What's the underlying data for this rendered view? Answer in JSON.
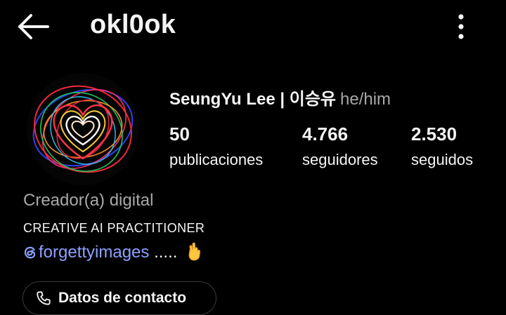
{
  "header": {
    "username": "okl0ok",
    "back_icon": "arrow-left-icon",
    "menu_icon": "kebab-menu-icon"
  },
  "profile": {
    "display_name": "SeungYu Lee | 이승유",
    "pronouns": "he/him",
    "avatar_icon": "neon-heart-avatar",
    "stats": [
      {
        "value": "50",
        "label": "publicaciones"
      },
      {
        "value": "4.766",
        "label": "seguidores"
      },
      {
        "value": "2.530",
        "label": "seguidos"
      }
    ],
    "category": "Creador(a) digital",
    "bio": "CREATIVE AI PRACTITIONER",
    "threads_handle": "forgettyimages",
    "threads_suffix": ".....",
    "threads_icon": "threads-icon",
    "emoji_icon": "crossed-fingers-emoji"
  },
  "contact_button": {
    "label": "Datos de contacto",
    "icon": "phone-icon"
  },
  "colors": {
    "background": "#000000",
    "text": "#f5f5f5",
    "muted": "#a8a8a8",
    "link": "#8da0ff",
    "border": "#3a3a3a"
  }
}
